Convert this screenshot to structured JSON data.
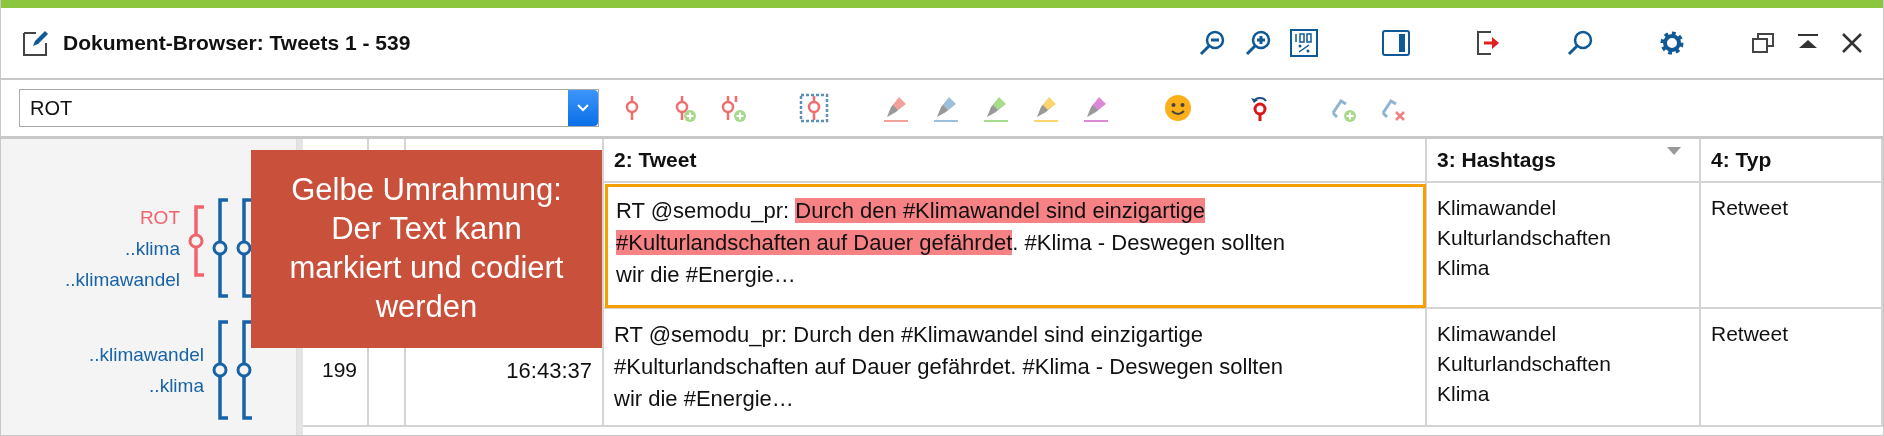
{
  "window": {
    "title": "Dokument-Browser: Tweets 1 - 539"
  },
  "code_selector": {
    "value": "ROT"
  },
  "code_margin": [
    {
      "codes": [
        {
          "label": "ROT",
          "color": "#f0646e",
          "short": true
        },
        {
          "label": "..klima",
          "color": "#1763a6",
          "short": false
        },
        {
          "label": "..klimawandel",
          "color": "#1763a6",
          "short": false
        }
      ]
    },
    {
      "codes": [
        {
          "label": "..klimawandel",
          "color": "#1763a6",
          "short": false
        },
        {
          "label": "..klima",
          "color": "#1763a6",
          "short": false
        }
      ]
    }
  ],
  "table": {
    "columns": [
      "2: Tweet",
      "3: Hashtags",
      "4: Typ"
    ],
    "rows": [
      {
        "selected": true,
        "tweet": [
          {
            "text": "RT @semodu_pr: ",
            "coded": false
          },
          {
            "text": "Durch den #Klimawandel sind einzigartige #Kulturlandschaften auf Dauer gefährdet",
            "coded": true
          },
          {
            "text": ". #Klima - Deswegen sollten wir die #Energie…",
            "coded": false
          }
        ],
        "hashtags": [
          "Klimawandel",
          "Kulturlandschaften",
          "Klima"
        ],
        "type": "Retweet"
      },
      {
        "selected": false,
        "number": "199",
        "datetime": [
          "16:43:37"
        ],
        "tweet": [
          {
            "text": "RT @semodu_pr: Durch den #Klimawandel sind einzigartige #Kulturlandschaften auf Dauer gefährdet. #Klima - Deswegen sollten wir die #Energie…",
            "coded": false
          }
        ],
        "hashtags": [
          "Klimawandel",
          "Kulturlandschaften",
          "Klima"
        ],
        "type": "Retweet"
      }
    ]
  },
  "callout": {
    "lines": [
      "Gelbe Umrahmung:",
      "Der Text kann",
      "markiert und codiert",
      "werden"
    ]
  }
}
